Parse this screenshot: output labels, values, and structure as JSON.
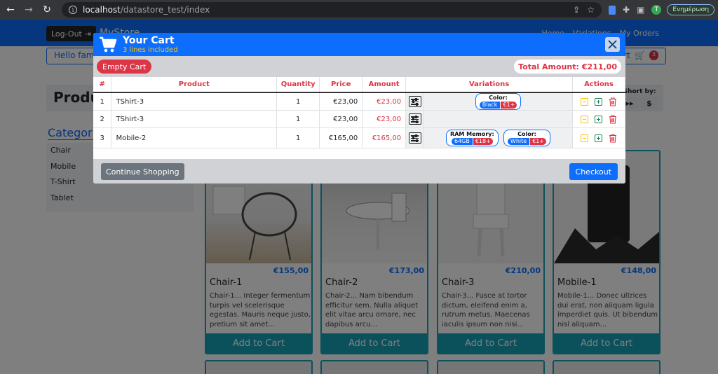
{
  "browser": {
    "url_host": "localhost",
    "url_path": "/datastore_test/index",
    "update_label": "Ενημέρωση",
    "profile_initial": "T"
  },
  "navbar": {
    "logout_label": "Log-Out",
    "brand": "MyStore",
    "links": [
      "Home",
      "Variations",
      "My Orders"
    ]
  },
  "hello": {
    "text": "Hello famo",
    "cart_label": "Cart",
    "cart_count": "3"
  },
  "products_header": {
    "title": "Produ",
    "sort_label": "Short by:"
  },
  "categories": {
    "title": "Categorie",
    "items": [
      "Chair",
      "Mobile",
      "T-Shirt",
      "Tablet"
    ]
  },
  "products": [
    {
      "name": "Chair-1",
      "price": "€155,00",
      "desc": "Chair-1... Integer fermentum turpis vel scelerisque egestas. Mauris neque justo, pretium sit amet...",
      "button": "Add to Cart"
    },
    {
      "name": "Chair-2",
      "price": "€173,00",
      "desc": "Chair-2... Nam bibendum efficitur sem. Nulla aliquet elit vitae arcu ornare, nec dapibus arcu...",
      "button": "Add to Cart"
    },
    {
      "name": "Chair-3",
      "price": "€210,00",
      "desc": "Chair-3... Fusce at tortor dictum, eleifend enim a, rutrum metus. Maecenas iaculis ipsum non nisi...",
      "button": "Add to Cart"
    },
    {
      "name": "Mobile-1",
      "price": "€148,00",
      "desc": "Mobile-1... Donec ultrices dui erat, non aliquam ligula imperdiet quis. Ut bibendum nisl aliquam...",
      "button": "Add to Cart"
    }
  ],
  "modal": {
    "title": "Your Cart",
    "subtitle": "3 lines included",
    "empty_label": "Empty Cart",
    "total_label": "Total Amount:",
    "total_value": "€211,00",
    "columns": [
      "#",
      "Product",
      "Quantity",
      "Price",
      "Amount",
      "Variations",
      "Actions"
    ],
    "rows": [
      {
        "num": "1",
        "product": "TShirt-3",
        "qty": "1",
        "price": "€23,00",
        "amount": "€23,00",
        "variations": [
          {
            "title": "Color:",
            "value": "Black",
            "extra": "€1+"
          }
        ]
      },
      {
        "num": "2",
        "product": "TShirt-3",
        "qty": "1",
        "price": "€23,00",
        "amount": "€23,00",
        "variations": []
      },
      {
        "num": "3",
        "product": "Mobile-2",
        "qty": "1",
        "price": "€165,00",
        "amount": "€165,00",
        "variations": [
          {
            "title": "RAM Memory:",
            "value": "64GB",
            "extra": "€18+"
          },
          {
            "title": "Color:",
            "value": "White",
            "extra": "€1+"
          }
        ]
      }
    ],
    "continue_label": "Continue Shopping",
    "checkout_label": "Checkout"
  },
  "colors": {
    "primary": "#0d6efd",
    "danger": "#dc3545",
    "warning": "#ffc107",
    "success": "#198754",
    "info": "#17a2b8",
    "secondary": "#6c757d"
  }
}
